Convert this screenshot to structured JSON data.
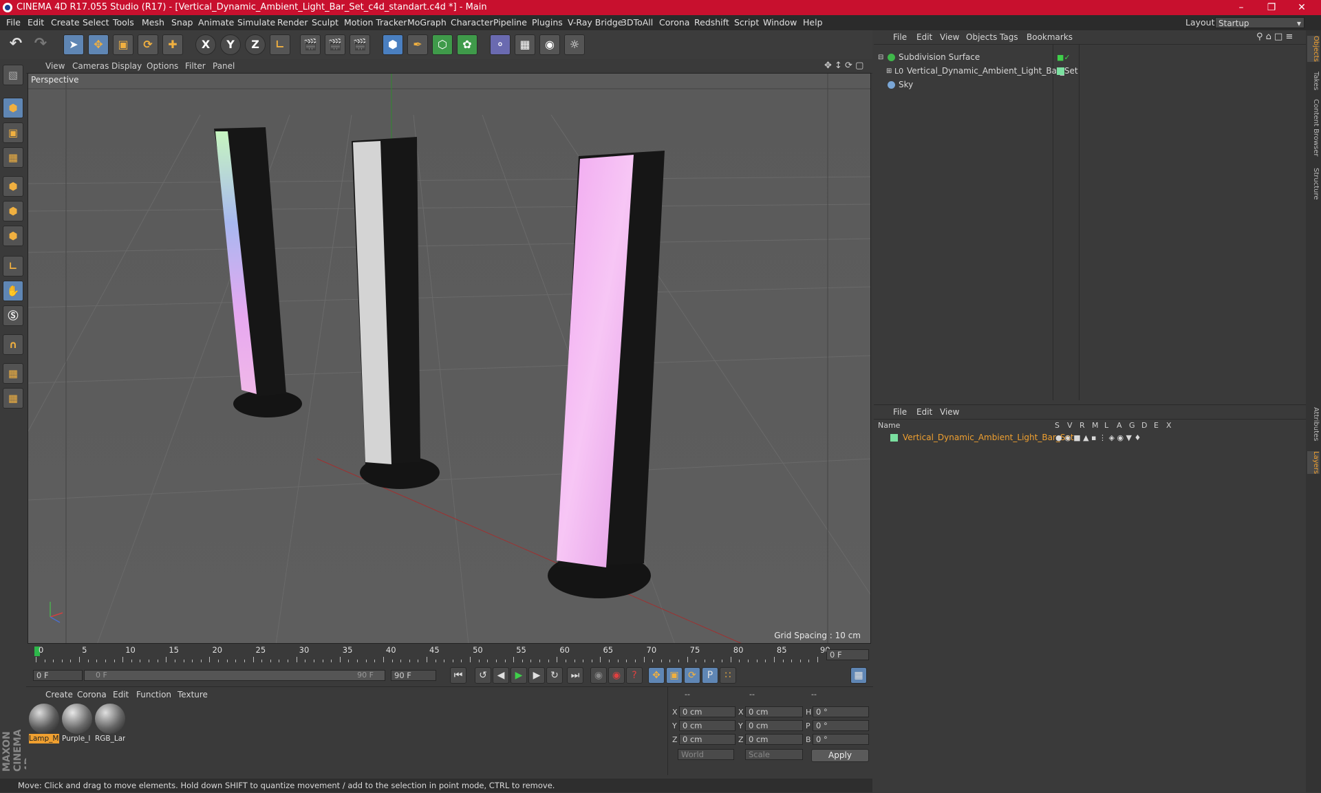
{
  "window": {
    "title": "CINEMA 4D R17.055 Studio (R17) - [Vertical_Dynamic_Ambient_Light_Bar_Set_c4d_standart.c4d *] - Main"
  },
  "menubar": [
    "File",
    "Edit",
    "Create",
    "Select",
    "Tools",
    "Mesh",
    "Snap",
    "Animate",
    "Simulate",
    "Render",
    "Sculpt",
    "Motion Tracker",
    "MoGraph",
    "Character",
    "Pipeline",
    "Plugins",
    "V-Ray Bridge",
    "3DToAll",
    "Corona",
    "Redshift",
    "Script",
    "Window",
    "Help"
  ],
  "layout": {
    "label": "Layout:",
    "value": "Startup"
  },
  "toolbar": {
    "axis_x": "X",
    "axis_y": "Y",
    "axis_z": "Z"
  },
  "viewport": {
    "menu": [
      "View",
      "Cameras",
      "Display",
      "Options",
      "Filter",
      "Panel"
    ],
    "label": "Perspective",
    "grid_spacing": "Grid Spacing : 10 cm"
  },
  "timeline": {
    "ticks": [
      "0",
      "5",
      "10",
      "15",
      "20",
      "25",
      "30",
      "35",
      "40",
      "45",
      "50",
      "55",
      "60",
      "65",
      "70",
      "75",
      "80",
      "85",
      "90"
    ],
    "current_frame": "0 F",
    "start_field": "0 F",
    "slider_start": "0 F",
    "slider_end": "90 F",
    "end_field": "90 F"
  },
  "materials": {
    "menu": [
      "Create",
      "Corona",
      "Edit",
      "Function",
      "Texture"
    ],
    "items": [
      {
        "name": "Lamp_M",
        "selected": true
      },
      {
        "name": "Purple_l",
        "selected": false
      },
      {
        "name": "RGB_Lar",
        "selected": false
      }
    ]
  },
  "coords": {
    "header": [
      "--",
      "--",
      "--"
    ],
    "rows": [
      {
        "a": "X",
        "av": "0 cm",
        "b": "X",
        "bv": "0 cm",
        "c": "H",
        "cv": "0 °"
      },
      {
        "a": "Y",
        "av": "0 cm",
        "b": "Y",
        "bv": "0 cm",
        "c": "P",
        "cv": "0 °"
      },
      {
        "a": "Z",
        "av": "0 cm",
        "b": "Z",
        "bv": "0 cm",
        "c": "B",
        "cv": "0 °"
      }
    ],
    "world": "World",
    "scale": "Scale",
    "apply": "Apply"
  },
  "status": "Move: Click and drag to move elements. Hold down SHIFT to quantize movement / add to the selection in point mode, CTRL to remove.",
  "objects": {
    "menu": [
      "File",
      "Edit",
      "View",
      "Objects",
      "Tags",
      "Bookmarks"
    ],
    "items": [
      {
        "name": "Subdivision Surface"
      },
      {
        "name": "Vertical_Dynamic_Ambient_Light_Bar_Set"
      },
      {
        "name": "Sky"
      }
    ]
  },
  "layers": {
    "menu": [
      "File",
      "Edit",
      "View"
    ],
    "headers": [
      "Name",
      "S",
      "V",
      "R",
      "M",
      "L",
      "A",
      "G",
      "D",
      "E",
      "X"
    ],
    "items": [
      {
        "name": "Vertical_Dynamic_Ambient_Light_Bar_Set"
      }
    ]
  },
  "side_tabs": [
    "Objects",
    "Takes",
    "Content Browser",
    "Structure",
    "Attributes",
    "Layers"
  ],
  "brand": "MAXON CINEMA 4D",
  "colors": {
    "titlebar": "#c8102e",
    "highlight": "#5f86b4",
    "layer_name": "#f0a030"
  }
}
